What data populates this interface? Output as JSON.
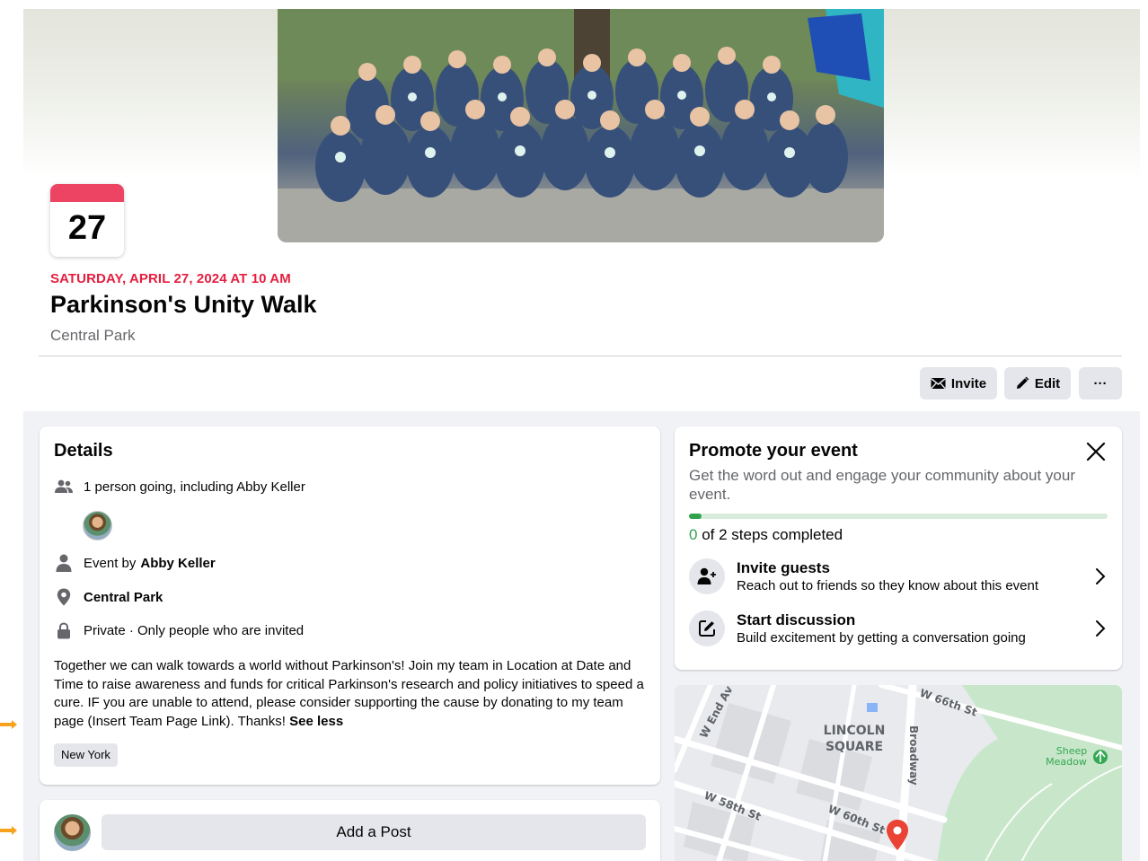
{
  "event": {
    "day": "27",
    "when": "SATURDAY, APRIL 27, 2024 AT 10 AM",
    "title": "Parkinson's Unity Walk",
    "place": "Central Park"
  },
  "actions": {
    "invite_label": "Invite",
    "edit_label": "Edit",
    "more_label": "···"
  },
  "details": {
    "heading": "Details",
    "going": "1 person going, including Abby Keller",
    "event_by_prefix": "Event by",
    "host": "Abby Keller",
    "location": "Central Park",
    "privacy": "Private · Only people who are invited",
    "description": "Together we can walk towards a world without Parkinson's! Join my team in Location at Date and Time to raise awareness and funds for critical Parkinson's research and policy initiatives to speed a cure. IF you are unable to attend, please consider supporting the cause by donating to my team page (Insert Team Page Link). Thanks!",
    "see_less": "See less",
    "tag": "New York"
  },
  "post": {
    "add_post_label": "Add a Post"
  },
  "promote": {
    "heading": "Promote your event",
    "subtitle": "Get the word out and engage your community about your event.",
    "progress_fraction": 0.03,
    "steps_done": "0",
    "steps_rest": "of 2 steps completed",
    "steps": [
      {
        "title": "Invite guests",
        "desc": "Reach out to friends so they know about this event",
        "icon": "add-person-icon"
      },
      {
        "title": "Start discussion",
        "desc": "Build excitement by getting a conversation going",
        "icon": "compose-icon"
      }
    ]
  },
  "map": {
    "labels": {
      "west_end_av": "W End Av",
      "w66": "W 66th St",
      "lincoln1": "LINCOLN",
      "lincoln2": "SQUARE",
      "broadway": "Broadway",
      "sheep1": "Sheep",
      "sheep2": "Meadow",
      "w58": "W 58th St",
      "w60": "W 60th St"
    }
  },
  "colors": {
    "accent_red": "#e41e3f",
    "calendar_bar": "#ed4463",
    "progress_green": "#31a24c",
    "button_gray": "#e4e6eb",
    "page_gray": "#f0f2f5"
  }
}
